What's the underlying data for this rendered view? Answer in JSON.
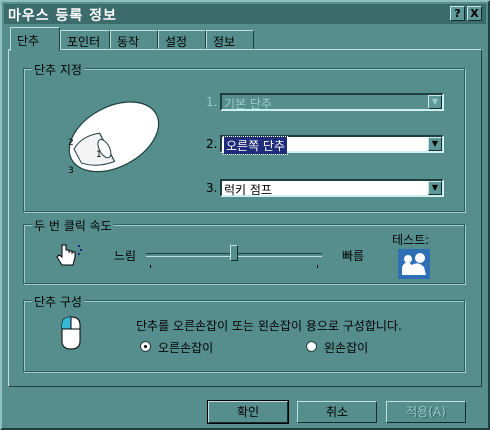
{
  "window": {
    "title": "마우스 등록 정보",
    "help_glyph": "?",
    "close_glyph": "X"
  },
  "tabs": [
    {
      "label": "단추",
      "active": true
    },
    {
      "label": "포인터"
    },
    {
      "label": "동작"
    },
    {
      "label": "설정"
    },
    {
      "label": "정보"
    }
  ],
  "button_assign": {
    "legend": "단추 지정",
    "illustration_labels": [
      "1",
      "2",
      "3"
    ],
    "rows": [
      {
        "num": "1.",
        "value": "기본 단추",
        "disabled": true
      },
      {
        "num": "2.",
        "value": "오른쪽 단추",
        "highlighted": true
      },
      {
        "num": "3.",
        "value": "럭키 점프"
      }
    ]
  },
  "double_click": {
    "legend": "두 번 클릭 속도",
    "slow_label": "느림",
    "fast_label": "빠름",
    "test_label": "테스트:",
    "slider_value": 0.5
  },
  "button_config": {
    "legend": "단추 구성",
    "description": "단추를 오른손잡이 또는 왼손잡이 용으로 구성합니다.",
    "options": [
      {
        "label": "오른손잡이",
        "selected": true
      },
      {
        "label": "왼손잡이",
        "selected": false
      }
    ]
  },
  "footer": {
    "ok": "확인",
    "cancel": "취소",
    "apply": "적용(A)"
  },
  "colors": {
    "face": "#568e8e",
    "title": "#3b6b6b",
    "highlight": "#1e2c7a"
  }
}
